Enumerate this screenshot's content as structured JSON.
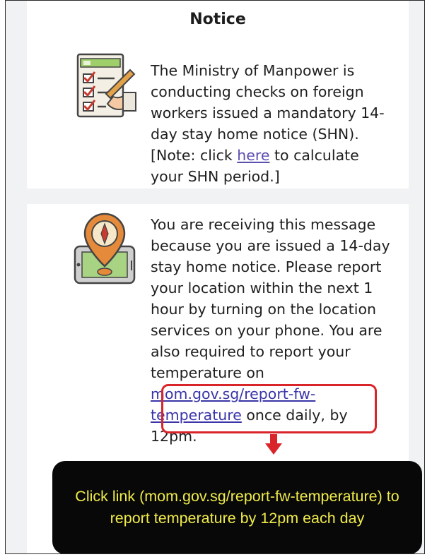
{
  "notice": {
    "title": "Notice",
    "message1_before_link": "The Ministry of Manpower is conducting checks on foreign workers issued a mandatory 14-day stay home notice (SHN). [Note: click ",
    "message1_link": "here",
    "message1_after_link": " to calculate your SHN period.]",
    "message2_before_link": "You are receiving this message because you are issued a 14-day stay home notice. Please report your location within the next 1 hour by turning on the location services on your phone. You are also required to report your temperature on ",
    "message2_link": "mom.gov.sg/report-fw-temperature",
    "message2_after_link": " once daily, by 12pm."
  },
  "annotation": {
    "callout_text": "Click link (mom.gov.sg/report-fw-temperature) to report temperature by 12pm each day"
  },
  "colors": {
    "link": "#5b4fb0",
    "highlight": "#d9252a",
    "callout_background": "#080808",
    "callout_text": "#f0eb4a"
  },
  "icons": {
    "checklist": "checklist-icon",
    "location": "location-pin-phone-icon",
    "arrow": "arrow-down-icon"
  }
}
